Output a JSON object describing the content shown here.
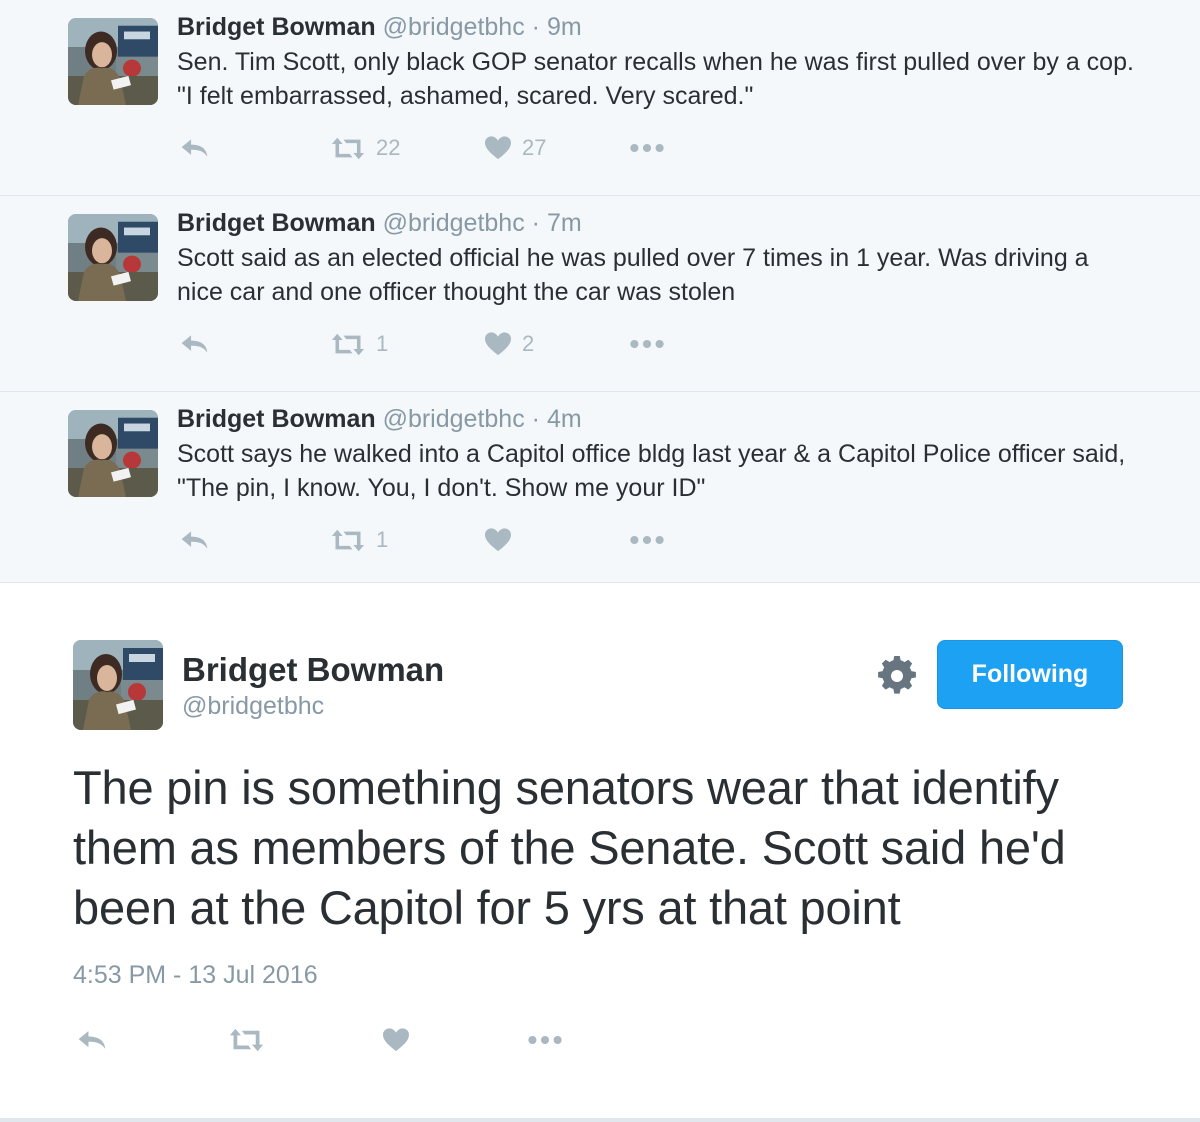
{
  "thread": [
    {
      "name": "Bridget Bowman",
      "handle": "@bridgetbhc",
      "time": "· 9m",
      "text": "Sen. Tim Scott, only black GOP senator recalls when he was first pulled over by a cop. \"I felt embarrassed, ashamed, scared. Very scared.\"",
      "retweets": "22",
      "likes": "27"
    },
    {
      "name": "Bridget Bowman",
      "handle": "@bridgetbhc",
      "time": "· 7m",
      "text": "Scott said as an elected official he was pulled over 7 times in 1 year. Was driving a nice car and one officer thought the car was stolen",
      "retweets": "1",
      "likes": "2"
    },
    {
      "name": "Bridget Bowman",
      "handle": "@bridgetbhc",
      "time": "· 4m",
      "text": "Scott says he walked into a Capitol office bldg last year & a Capitol Police officer said, \"The pin, I know. You, I don't. Show me your ID\"",
      "retweets": "1",
      "likes": ""
    }
  ],
  "main_tweet": {
    "name": "Bridget Bowman",
    "handle": "@bridgetbhc",
    "follow_label": "Following",
    "text": "The pin is something senators wear that identify them as members of the Senate. Scott said he'd been at the Capitol for 5 yrs at that point",
    "timestamp": "4:53 PM - 13 Jul 2016"
  },
  "icons": {
    "reply": "reply-icon",
    "retweet": "retweet-icon",
    "like": "heart-icon",
    "more": "more-icon",
    "settings": "gear-icon"
  },
  "colors": {
    "accent": "#1da1f2",
    "muted": "#aab8c2",
    "thread_bg": "#f5f8fa"
  }
}
